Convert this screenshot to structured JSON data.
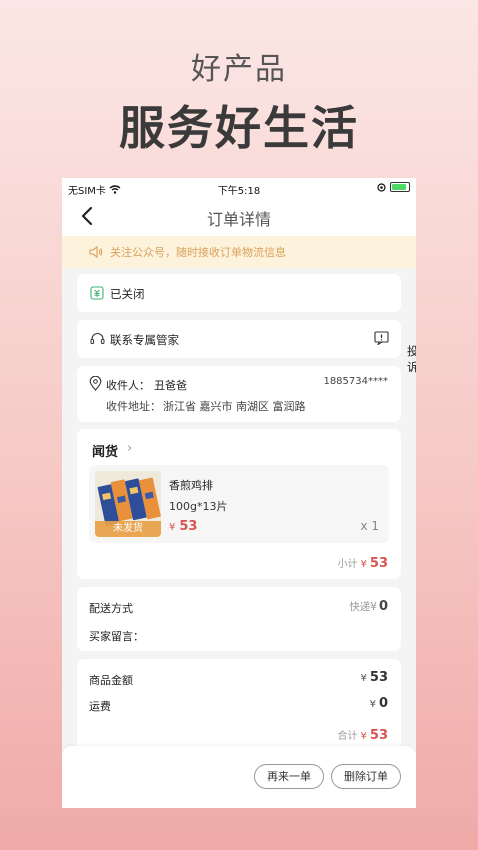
{
  "promo": {
    "subtitle": "好产品",
    "title": "服务好生活"
  },
  "status_bar": {
    "carrier": "无SIM卡",
    "time": "下午5:18"
  },
  "nav": {
    "title": "订单详情"
  },
  "notice": {
    "text": "关注公众号，随时接收订单物流信息"
  },
  "order": {
    "status": "已关闭",
    "contact_label": "联系专属管家",
    "complain_label": "投诉"
  },
  "address": {
    "receiver_label": "收件人：",
    "receiver_name": "丑爸爸",
    "phone": "1885734****",
    "addr_label": "收件地址：",
    "addr_value": "浙江省 嘉兴市 南湖区 富润路"
  },
  "goods": {
    "store_name": "闻货",
    "items": [
      {
        "name": "香煎鸡排",
        "spec": "100g*13片",
        "currency": "¥",
        "price": "53",
        "qty": "x 1",
        "badge": "未发货"
      }
    ],
    "subtotal_label": "小计",
    "subtotal_currency": "¥",
    "subtotal": "53"
  },
  "delivery": {
    "method_label": "配送方式",
    "method_value": "快递",
    "method_currency": "¥",
    "method_fee": "0",
    "message_label": "买家留言："
  },
  "summary": {
    "goods_amount_label": "商品金额",
    "goods_currency": "¥",
    "goods_amount": "53",
    "shipping_label": "运费",
    "shipping_currency": "¥",
    "shipping": "0",
    "total_label": "合计",
    "total_currency": "¥",
    "total": "53"
  },
  "actions": {
    "rebuy": "再来一单",
    "delete": "删除订单"
  },
  "colors": {
    "accent_red": "#d9534f",
    "notice_bg": "#fdf3dc",
    "notice_text": "#d9a05a",
    "badge_orange": "#e8a046"
  }
}
